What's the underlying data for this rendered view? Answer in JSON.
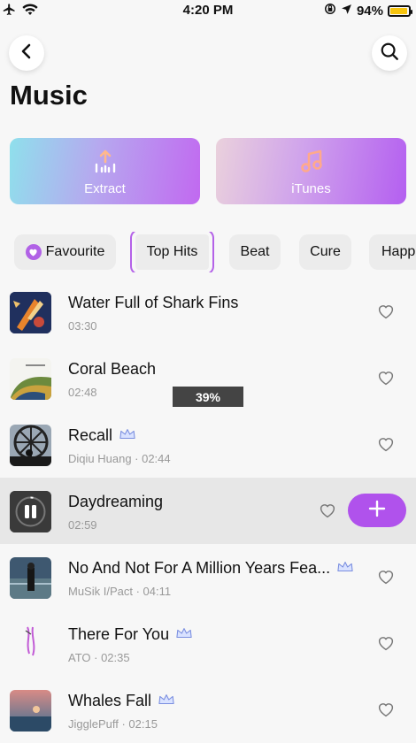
{
  "status_bar": {
    "time": "4:20 PM",
    "battery": "94%"
  },
  "header": {
    "title": "Music"
  },
  "sources": [
    {
      "label": "Extract",
      "icon": "extract-icon"
    },
    {
      "label": "iTunes",
      "icon": "music-note-icon"
    }
  ],
  "chips": [
    {
      "label": "Favourite",
      "icon": "heart-icon"
    },
    {
      "label": "Top Hits"
    },
    {
      "label": "Beat"
    },
    {
      "label": "Cure"
    },
    {
      "label": "Happ"
    }
  ],
  "songs": [
    {
      "title": "Water Full of Shark Fins",
      "subtitle": "03:30",
      "premium": false
    },
    {
      "title": "Coral Beach",
      "subtitle": "02:48",
      "premium": false
    },
    {
      "title": "Recall",
      "subtitle": "Diqiu Huang · 02:44",
      "premium": true
    },
    {
      "title": "Daydreaming",
      "subtitle": "02:59",
      "premium": false,
      "playing": true
    },
    {
      "title": "No And Not For A Million Years Fea...",
      "subtitle": "MuSik I/Pact · 04:11",
      "premium": true
    },
    {
      "title": "There For You",
      "subtitle": "ATO · 02:35",
      "premium": true
    },
    {
      "title": "Whales Fall",
      "subtitle": "JigglePuff · 02:15",
      "premium": true
    }
  ],
  "download_progress": {
    "label": "39%",
    "value": 0.39
  },
  "colors": {
    "accent": "#b052ec",
    "active_border": "#b462e8"
  }
}
